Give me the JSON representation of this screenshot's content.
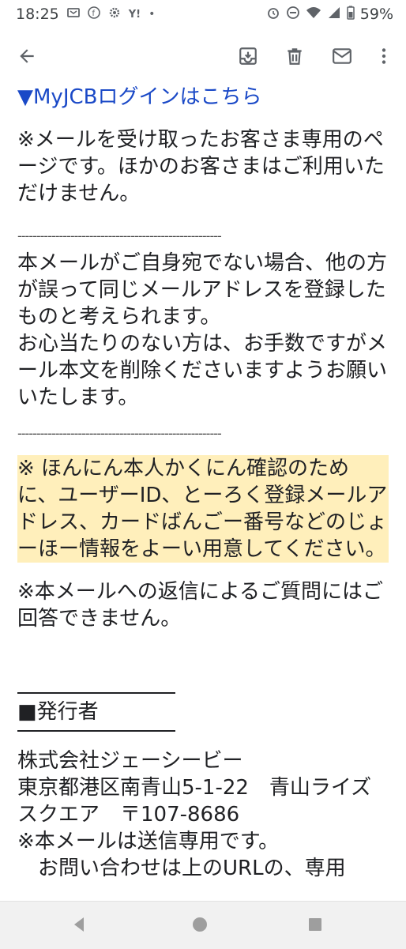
{
  "status": {
    "time": "18:25",
    "notif_label": "Y!",
    "battery": "59%"
  },
  "toolbar": {
    "icons": [
      "back-arrow-icon",
      "archive-icon",
      "delete-icon",
      "mail-icon",
      "more-vert-icon"
    ]
  },
  "email": {
    "link": "▼MyJCBログインはこちら",
    "notice1": "※メールを受け取ったお客さま専用のページです。ほかのお客さまはご利用いただけません。",
    "dashes1": "------------------------------------------------------",
    "para2": "本メールがご自身宛でない場合、他の方が誤って同じメールアドレスを登録したものと考えられます。",
    "para3": "お心当たりのない方は、お手数ですがメール本文を削除くださいますようお願いいたします。",
    "dashes2": "------------------------------------------------------",
    "notice2": "※ ほんにん本人かくにん確認のために、ユーザーID、とーろく登録メールアドレス、カードばんごー番号などのじょーほー情報をよーい用意してください。",
    "notice3": "※本メールへの返信によるご質問にはご回答できません。",
    "publisher_heading": "■発行者",
    "company": "株式会社ジェーシービー",
    "address": "東京都港区南青山5-1-22　青山ライズスクエア　〒107-8686",
    "send_only": "※本メールは送信専用です。",
    "inquiry": "　お問い合わせは上のURLの、専用"
  },
  "colors": {
    "link": "#1a49c7",
    "highlight": "#ffd23c"
  }
}
